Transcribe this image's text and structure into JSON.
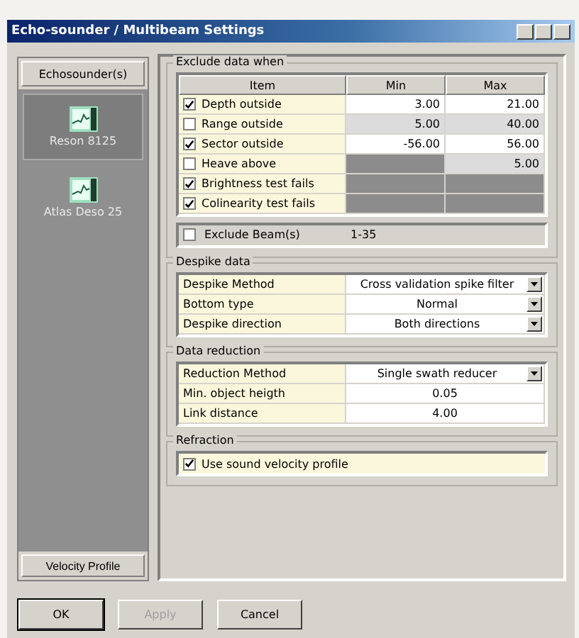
{
  "window": {
    "title": "Echo-sounder / Multibeam Settings"
  },
  "sidebar": {
    "header": "Echosounder(s)",
    "items": [
      {
        "label": "Reson 8125",
        "selected": true
      },
      {
        "label": "Atlas Deso 25",
        "selected": false
      }
    ],
    "footer": "Velocity Profile"
  },
  "exclude": {
    "title": "Exclude data when",
    "columns": [
      "Item",
      "Min",
      "Max"
    ],
    "rows": [
      {
        "label": "Depth outside",
        "checked": true,
        "min": "3.00",
        "max": "21.00"
      },
      {
        "label": "Range outside",
        "checked": false,
        "min": "5.00",
        "max": "40.00"
      },
      {
        "label": "Sector outside",
        "checked": true,
        "min": "-56.00",
        "max": "56.00"
      },
      {
        "label": "Heave above",
        "checked": false,
        "max": "5.00"
      },
      {
        "label": "Brightness test fails",
        "checked": true
      },
      {
        "label": "Colinearity test fails",
        "checked": true
      }
    ],
    "beams": {
      "label": "Exclude Beam(s)",
      "checked": false,
      "value": "1-35"
    }
  },
  "despike": {
    "title": "Despike data",
    "rows": [
      {
        "label": "Despike Method",
        "value": "Cross validation spike filter",
        "kind": "dropdown"
      },
      {
        "label": "Bottom type",
        "value": "Normal",
        "kind": "dropdown"
      },
      {
        "label": "Despike direction",
        "value": "Both directions",
        "kind": "dropdown"
      }
    ]
  },
  "reduction": {
    "title": "Data reduction",
    "rows": [
      {
        "label": "Reduction Method",
        "value": "Single swath reducer",
        "kind": "dropdown"
      },
      {
        "label": "Min. object heigth",
        "value": "0.05",
        "kind": "text"
      },
      {
        "label": "Link distance",
        "value": "4.00",
        "kind": "text"
      }
    ]
  },
  "refraction": {
    "title": "Refraction",
    "option": {
      "label": "Use sound velocity profile",
      "checked": true
    }
  },
  "buttons": [
    {
      "label": "OK",
      "disabled": false
    },
    {
      "label": "Apply",
      "disabled": true
    },
    {
      "label": "Cancel",
      "disabled": false
    }
  ]
}
